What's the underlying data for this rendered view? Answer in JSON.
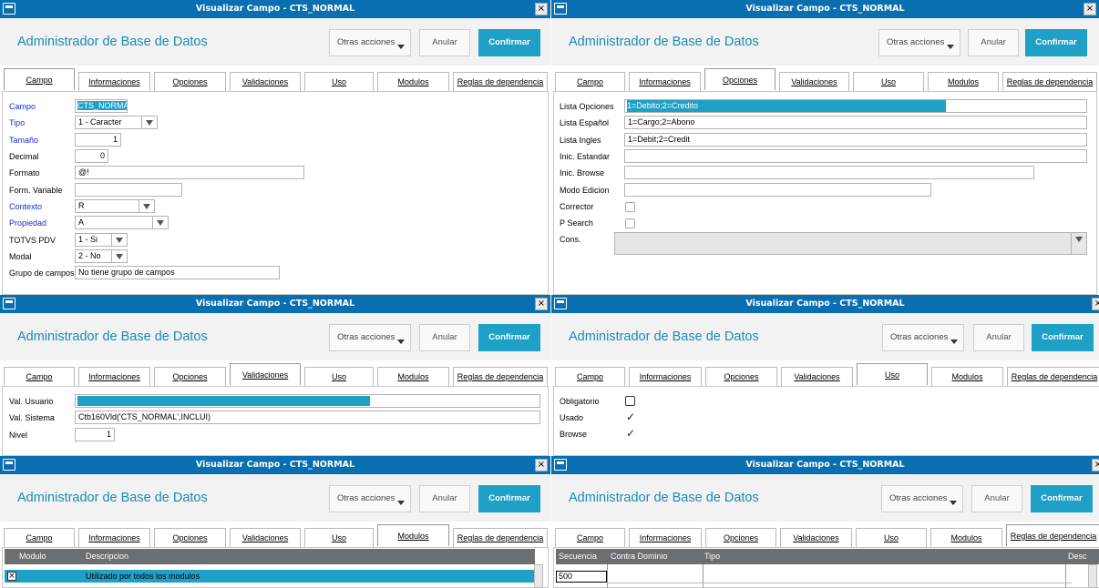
{
  "window_title": "Visualizar Campo - CTS_NORMAL",
  "app_title": "Administrador de Base de Datos",
  "buttons": {
    "otras": "Otras acciones",
    "anular": "Anular",
    "confirmar": "Confirmar"
  },
  "close_glyph": "×",
  "tabs": [
    "Campo",
    "Informaciones",
    "Opciones",
    "Validaciones",
    "Uso",
    "Modulos",
    "Reglas de dependencia"
  ],
  "campo": {
    "labels": {
      "campo": "Campo",
      "tipo": "Tipo",
      "tamano": "Tamaño",
      "decimal": "Decimal",
      "formato": "Formato",
      "form_variable": "Form. Variable",
      "contexto": "Contexto",
      "propiedad": "Propiedad",
      "totvs_pdv": "TOTVS PDV",
      "modal": "Modal",
      "grupo": "Grupo de campos"
    },
    "values": {
      "campo": "CTS_NORMA",
      "tipo": "1 - Caracter",
      "tamano": "1",
      "decimal": "0",
      "formato": "@!",
      "form_variable": "",
      "contexto": "R",
      "propiedad": "A",
      "totvs_pdv": "1 - Si",
      "modal": "2 - No",
      "grupo": "No tiene grupo de campos"
    }
  },
  "opciones": {
    "labels": {
      "lista": "Lista Opciones",
      "espanol": "Lista Español",
      "ingles": "Lista Ingles",
      "inc_estandar": "Inic. Estandar",
      "inc_browse": "Inic. Browse",
      "modo": "Modo Edicion",
      "corrector": "Corrector",
      "psearch": "P Search",
      "cons": "Cons."
    },
    "values": {
      "lista": "1=Debito;2=Credito",
      "espanol": "1=Cargo;2=Abono",
      "ingles": "1=Debit;2=Credit",
      "inc_estandar": "",
      "inc_browse": "",
      "modo": "",
      "cons": ""
    }
  },
  "validaciones": {
    "labels": {
      "usuario": "Val. Usuario",
      "sistema": "Val. Sistema",
      "nivel": "Nivel"
    },
    "values": {
      "usuario": "",
      "sistema": "Ctb160Vld('CTS_NORMAL',INCLUI)",
      "nivel": "1"
    }
  },
  "uso": {
    "labels": {
      "obligatorio": "Obligatorio",
      "usado": "Usado",
      "browse": "Browse"
    },
    "checked": {
      "obligatorio": false,
      "usado": true,
      "browse": true
    },
    "check_glyph": "✓"
  },
  "modulos": {
    "headers": [
      "Modulo",
      "Descripcion"
    ],
    "rows": [
      {
        "modulo": "",
        "descripcion": "Utilizado por todos los modulos",
        "checked": true
      }
    ]
  },
  "reglas": {
    "headers": [
      "Secuencia",
      "Contra Dominio",
      "Tipo",
      "Desc"
    ],
    "rows": [
      {
        "secuencia": "500"
      }
    ]
  },
  "colors": {
    "titlebar": "#0a6fb0",
    "accent": "#1fa0c6",
    "app_title": "#1a8bb6",
    "label_blue": "#1030d0",
    "grid_header": "#6b6f72"
  }
}
